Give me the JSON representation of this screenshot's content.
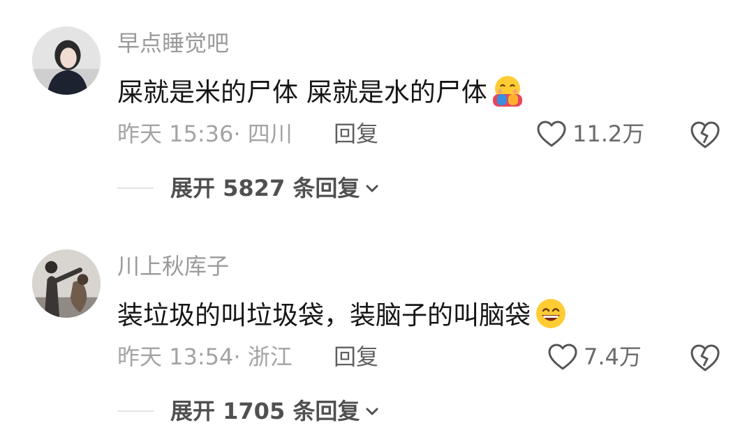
{
  "comments": [
    {
      "username": "早点睡觉吧",
      "text": "屎就是米的尸体 屎就是水的尸体",
      "emoji": "smiling-face-with-hearts-hugging",
      "time_location": "昨天 15:36· 四川",
      "reply_label": "回复",
      "likes": "11.2万",
      "expand_label": "展开 5827 条回复"
    },
    {
      "username": "川上秋库子",
      "text": "装垃圾的叫垃圾袋，装脑子的叫脑袋",
      "emoji": "grinning-face-with-smiling-eyes",
      "time_location": "昨天 13:54· 浙江",
      "reply_label": "回复",
      "likes": "7.4万",
      "expand_label": "展开 1705 条回复"
    }
  ]
}
